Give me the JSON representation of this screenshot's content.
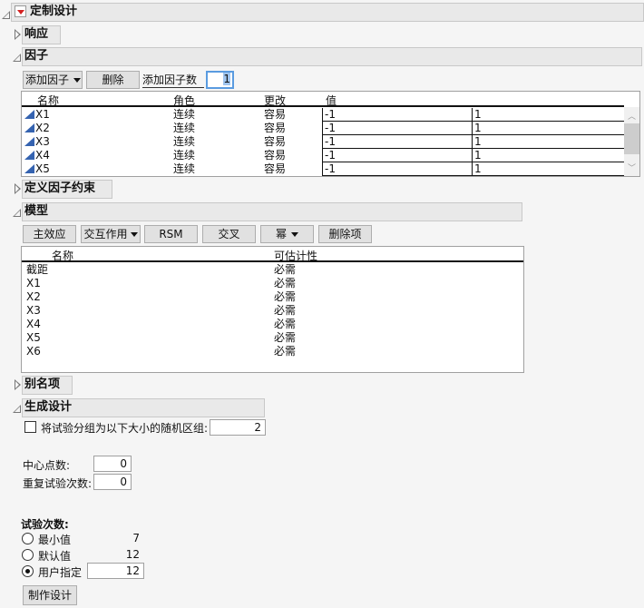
{
  "title": "定制设计",
  "sections": {
    "responses": "响应",
    "factors": "因子",
    "constraints": "定义因子约束",
    "model": "模型",
    "alias": "别名项",
    "generate": "生成设计"
  },
  "factors": {
    "add_factor": "添加因子",
    "remove": "删除",
    "add_count_label": "添加因子数",
    "add_count": "1",
    "columns": [
      "名称",
      "角色",
      "更改",
      "值"
    ],
    "rows": [
      {
        "name": "X1",
        "role": "连续",
        "changes": "容易",
        "low": "-1",
        "high": "1"
      },
      {
        "name": "X2",
        "role": "连续",
        "changes": "容易",
        "low": "-1",
        "high": "1"
      },
      {
        "name": "X3",
        "role": "连续",
        "changes": "容易",
        "low": "-1",
        "high": "1"
      },
      {
        "name": "X4",
        "role": "连续",
        "changes": "容易",
        "low": "-1",
        "high": "1"
      },
      {
        "name": "X5",
        "role": "连续",
        "changes": "容易",
        "low": "-1",
        "high": "1"
      }
    ]
  },
  "model": {
    "buttons": [
      "主效应",
      "交互作用",
      "RSM",
      "交叉",
      "幂",
      "删除项"
    ],
    "columns": [
      "名称",
      "可估计性"
    ],
    "rows": [
      {
        "name": "截距",
        "est": "必需"
      },
      {
        "name": "X1",
        "est": "必需"
      },
      {
        "name": "X2",
        "est": "必需"
      },
      {
        "name": "X3",
        "est": "必需"
      },
      {
        "name": "X4",
        "est": "必需"
      },
      {
        "name": "X5",
        "est": "必需"
      },
      {
        "name": "X6",
        "est": "必需"
      }
    ]
  },
  "generate": {
    "block_label": "将试验分组为以下大小的随机区组:",
    "block_checked": false,
    "block_size": "2",
    "center_label": "中心点数:",
    "center": "0",
    "replicate_label": "重复试验次数:",
    "replicate": "0",
    "runs_label": "试验次数:",
    "min_label": "最小值",
    "min": "7",
    "default_label": "默认值",
    "default": "12",
    "user_label": "用户指定",
    "user": "12",
    "selected": "user",
    "make_design": "制作设计"
  },
  "colors": {
    "accent": "#3563b0",
    "red": "#d42020"
  }
}
